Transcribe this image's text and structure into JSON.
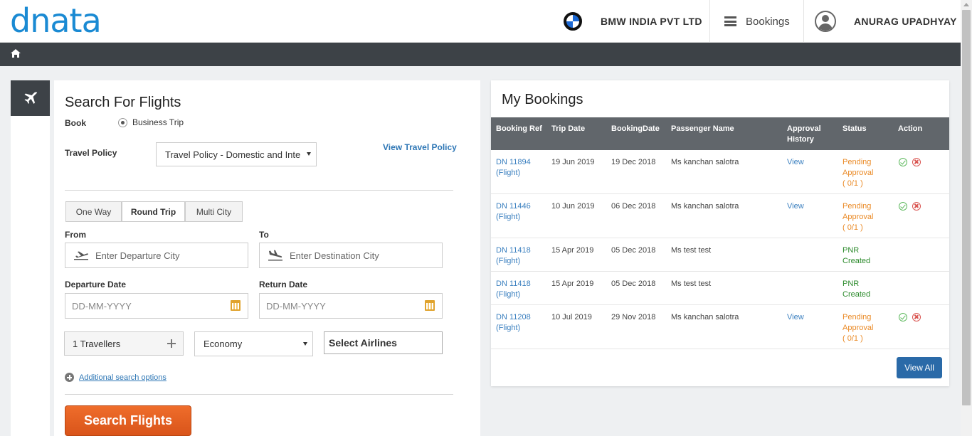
{
  "header": {
    "logo_text": "dnata",
    "company_name": "BMW INDIA PVT LTD",
    "bookings_label": "Bookings",
    "user_name": "ANURAG UPADHYAY",
    "brand_color": "#1a8ad3"
  },
  "search": {
    "title": "Search For Flights",
    "book_label": "Book",
    "book_option": "Business Trip",
    "policy_label": "Travel Policy",
    "policy_value": "Travel Policy - Domestic and International",
    "policy_link": "View Travel Policy",
    "trip_types": [
      "One Way",
      "Round Trip",
      "Multi City"
    ],
    "active_trip_type": "Round Trip",
    "from_label": "From",
    "from_placeholder": "Enter Departure City",
    "to_label": "To",
    "to_placeholder": "Enter Destination City",
    "departure_label": "Departure Date",
    "return_label": "Return Date",
    "date_placeholder": "DD-MM-YYYY",
    "travellers": "1 Travellers",
    "cabin_class": "Economy",
    "airlines": "Select Airlines",
    "additional_options": "Additional search options",
    "search_button": "Search Flights",
    "button_color": "#e2601f"
  },
  "bookings": {
    "title": "My Bookings",
    "columns": [
      "Booking Ref",
      "Trip Date",
      "BookingDate",
      "Passenger Name",
      "Approval History",
      "Status",
      "Action"
    ],
    "rows": [
      {
        "ref": "DN 11894",
        "type": "(Flight)",
        "trip_date": "19 Jun 2019",
        "booking_date": "19 Dec 2018",
        "passenger": "Ms kanchan salotra",
        "approval": "View",
        "status": "Pending Approval",
        "status_detail": "( 0/1 )",
        "status_kind": "pending",
        "actions": [
          "approve-icon",
          "reject-icon"
        ]
      },
      {
        "ref": "DN 11446",
        "type": "(Flight)",
        "trip_date": "10 Jun 2019",
        "booking_date": "06 Dec 2018",
        "passenger": "Ms kanchan salotra",
        "approval": "View",
        "status": "Pending Approval",
        "status_detail": "( 0/1 )",
        "status_kind": "pending",
        "actions": [
          "approve-icon",
          "reject-icon"
        ]
      },
      {
        "ref": "DN 11418",
        "type": "(Flight)",
        "trip_date": "15 Apr 2019",
        "booking_date": "05 Dec 2018",
        "passenger": "Ms test test",
        "approval": "",
        "status": "PNR Created",
        "status_detail": "",
        "status_kind": "pnr",
        "actions": []
      },
      {
        "ref": "DN 11418",
        "type": "(Flight)",
        "trip_date": "15 Apr 2019",
        "booking_date": "05 Dec 2018",
        "passenger": "Ms test test",
        "approval": "",
        "status": "PNR Created",
        "status_detail": "",
        "status_kind": "pnr",
        "actions": []
      },
      {
        "ref": "DN 11208",
        "type": "(Flight)",
        "trip_date": "10 Jul 2019",
        "booking_date": "29 Nov 2018",
        "passenger": "Ms kanchan salotra",
        "approval": "View",
        "status": "Pending Approval",
        "status_detail": "( 0/1 )",
        "status_kind": "pending",
        "actions": [
          "approve-icon",
          "reject-icon"
        ]
      }
    ],
    "view_all": "View All",
    "pending_color": "#ea8a26",
    "pnr_color": "#2b8a2b"
  }
}
